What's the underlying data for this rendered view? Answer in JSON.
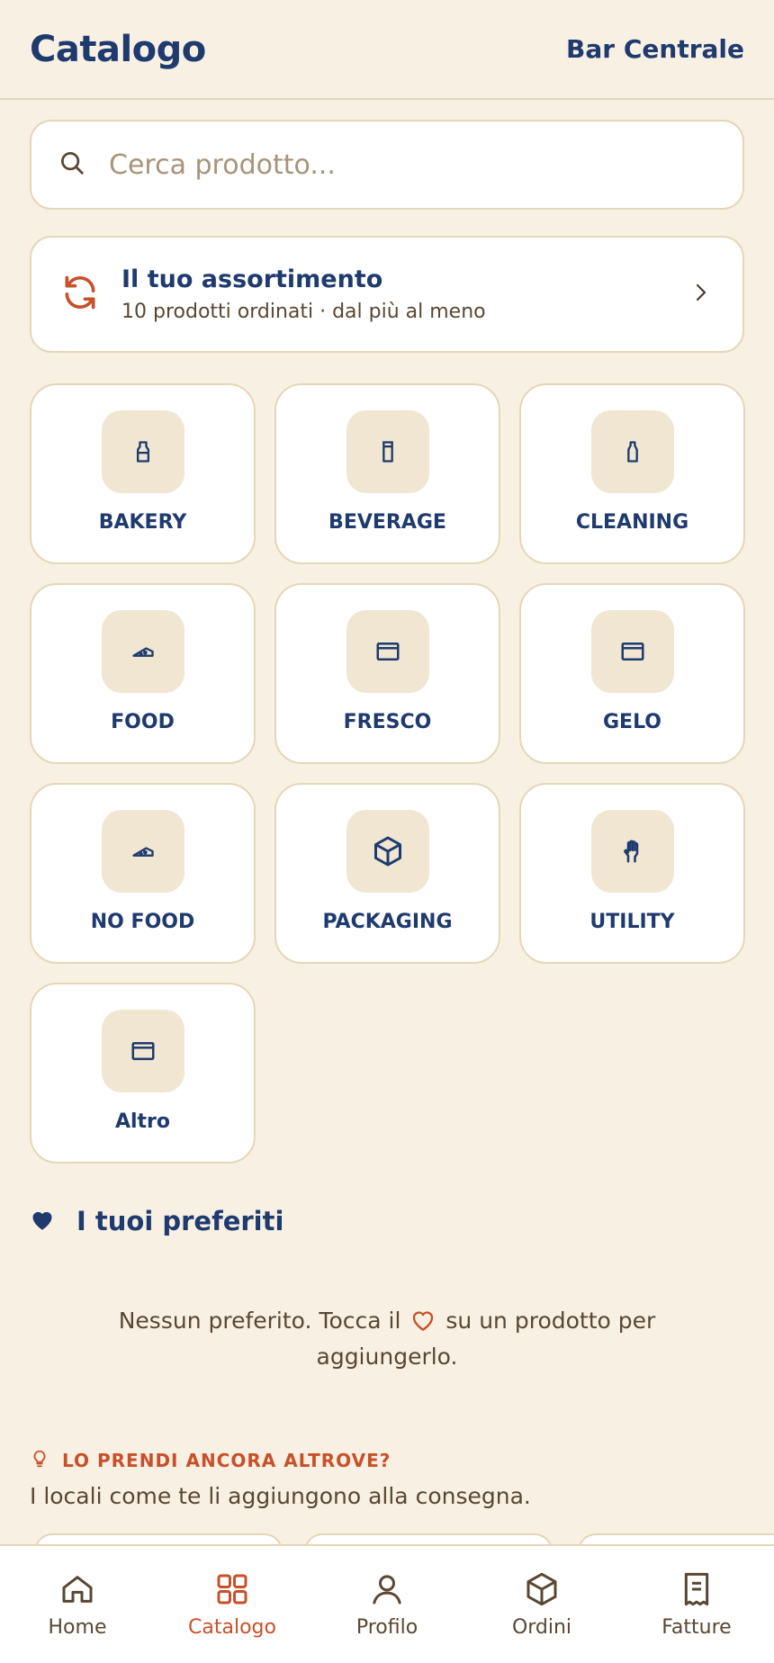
{
  "header": {
    "title": "Catalogo",
    "venue": "Bar Centrale"
  },
  "search": {
    "placeholder": "Cerca prodotto..."
  },
  "assortment": {
    "title": "Il tuo assortimento",
    "subtitle": "10 prodotti ordinati · dal più al meno"
  },
  "categories": [
    {
      "label": "BAKERY",
      "icon": "bottle-icon"
    },
    {
      "label": "BEVERAGE",
      "icon": "glass-icon"
    },
    {
      "label": "CLEANING",
      "icon": "spray-bottle-icon"
    },
    {
      "label": "FOOD",
      "icon": "cheese-icon"
    },
    {
      "label": "FRESCO",
      "icon": "window-icon"
    },
    {
      "label": "GELO",
      "icon": "window-icon"
    },
    {
      "label": "NO FOOD",
      "icon": "cheese-icon"
    },
    {
      "label": "PACKAGING",
      "icon": "box-icon"
    },
    {
      "label": "UTILITY",
      "icon": "glove-icon"
    },
    {
      "label": "Altro",
      "icon": "window-icon"
    }
  ],
  "favorites": {
    "title": "I tuoi preferiti",
    "empty_before": "Nessun preferito. Tocca il",
    "empty_after": "su un prodotto per aggiungerlo."
  },
  "suggestions": {
    "kicker": "LO PRENDI ANCORA ALTROVE?",
    "subtitle": "I locali come te li aggiungono alla consegna."
  },
  "nav": [
    {
      "label": "Home",
      "icon": "home-icon",
      "active": false
    },
    {
      "label": "Catalogo",
      "icon": "grid-icon",
      "active": true
    },
    {
      "label": "Profilo",
      "icon": "user-icon",
      "active": false
    },
    {
      "label": "Ordini",
      "icon": "box-icon",
      "active": false
    },
    {
      "label": "Fatture",
      "icon": "receipt-icon",
      "active": false
    }
  ],
  "colors": {
    "background": "#f8f1e3",
    "primary": "#1e3a6e",
    "accent": "#c8502a",
    "tile": "#f0e6d2"
  }
}
